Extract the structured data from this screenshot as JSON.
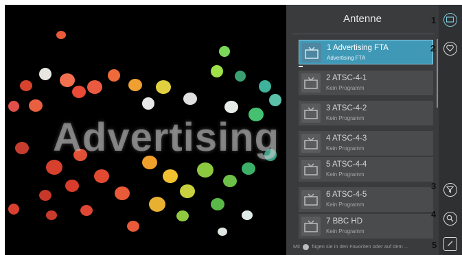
{
  "video": {
    "overlay_text": "Advertising"
  },
  "panel": {
    "title": "Antenne",
    "channels": [
      {
        "name": "1 Advertising FTA",
        "sub": "Advertising FTA"
      },
      {
        "name": "2 ATSC-4-1",
        "sub": "Kein Programm"
      },
      {
        "name": "3 ATSC-4-2",
        "sub": "Kein Programm"
      },
      {
        "name": "4 ATSC-4-3",
        "sub": "Kein Programm"
      },
      {
        "name": "5 ATSC-4-4",
        "sub": "Kein Programm"
      },
      {
        "name": "6 ATSC-4-5",
        "sub": "Kein Programm"
      },
      {
        "name": "7 BBC HD",
        "sub": "Kein Programm"
      }
    ],
    "hint_prefix": "Mit",
    "hint_suffix": "fügen sie in den Favoriten oder auf dem ..."
  },
  "sidebar_icons": [
    "tv-icon",
    "heart-icon",
    "filter-icon",
    "search-icon",
    "edit-icon"
  ],
  "callouts": [
    "1",
    "2",
    "3",
    "4",
    "5"
  ],
  "colors": {
    "accent": "#3f98b6",
    "panel_bg": "#3a3b3d",
    "item_bg": "#4a4b4d"
  }
}
